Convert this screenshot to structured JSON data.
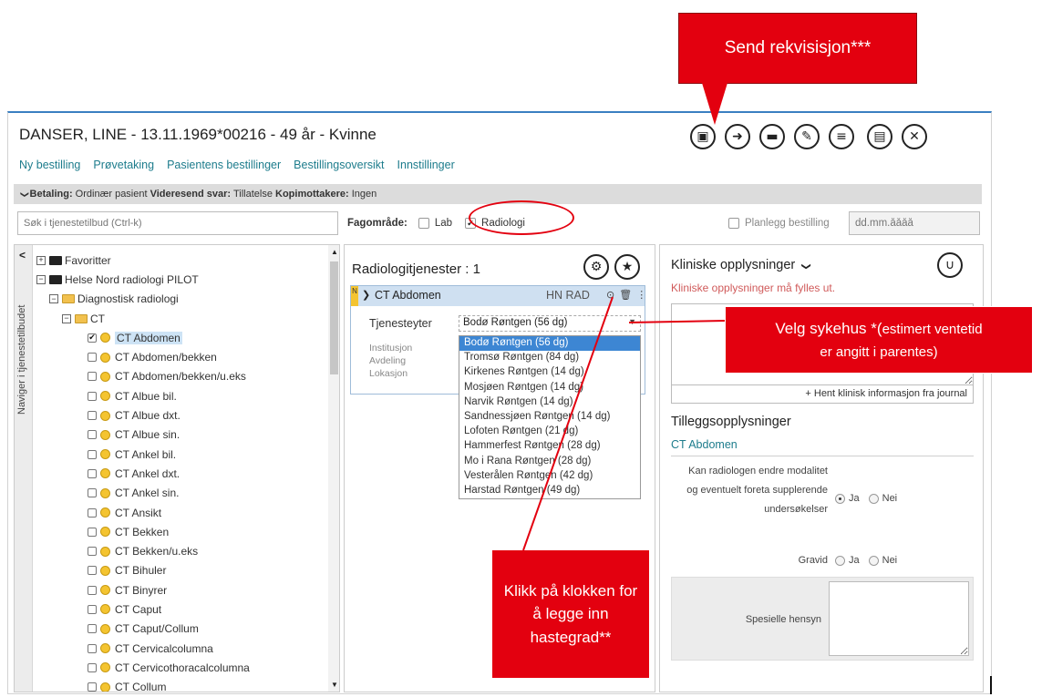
{
  "annotations": {
    "send": "Send rekvisisjon***",
    "velg_main": "Velg sykehus *(",
    "velg_rest": "estimert ventetid",
    "velg_line2": "er angitt i parentes)",
    "klikk": "Klikk på klokken for å legge inn hastegrad**"
  },
  "header": {
    "patient_title": "DANSER, LINE - 13.11.1969*00216 - 49 år - Kvinne",
    "icons": [
      "save-icon",
      "send-icon",
      "message-icon",
      "notes-icon",
      "list-icon",
      "document-icon",
      "close-icon"
    ]
  },
  "nav_tabs": [
    "Ny bestilling",
    "Prøvetaking",
    "Pasientens bestillinger",
    "Bestillingsoversikt",
    "Innstillinger"
  ],
  "info_bar": {
    "chevron": "❯",
    "betaling_label": "Betaling:",
    "betaling_value": "Ordinær pasient",
    "videresend_label": "Videresend svar:",
    "videresend_value": "Tillatelse",
    "kopi_label": "Kopimottakere:",
    "kopi_value": "Ingen"
  },
  "search": {
    "placeholder": "Søk i tjenestetilbud (Ctrl-k)"
  },
  "fagomrade": {
    "label": "Fagområde:",
    "lab": "Lab",
    "lab_checked": false,
    "radiologi": "Radiologi",
    "radiologi_checked": true
  },
  "planlegg": {
    "label": "Planlegg bestilling",
    "date_placeholder": "dd.mm.åååå"
  },
  "sidebar": {
    "vertical_label": "Naviger i tjenestetilbudet"
  },
  "tree": {
    "favoritter": "Favoritter",
    "helse_nord": "Helse Nord radiologi PILOT",
    "diagnostisk": "Diagnostisk radiologi",
    "ct": "CT",
    "items": [
      {
        "label": "CT Abdomen",
        "checked": true
      },
      {
        "label": "CT Abdomen/bekken",
        "checked": false
      },
      {
        "label": "CT Abdomen/bekken/u.eks",
        "checked": false
      },
      {
        "label": "CT Albue bil.",
        "checked": false
      },
      {
        "label": "CT Albue dxt.",
        "checked": false
      },
      {
        "label": "CT Albue sin.",
        "checked": false
      },
      {
        "label": "CT Ankel bil.",
        "checked": false
      },
      {
        "label": "CT Ankel dxt.",
        "checked": false
      },
      {
        "label": "CT Ankel sin.",
        "checked": false
      },
      {
        "label": "CT Ansikt",
        "checked": false
      },
      {
        "label": "CT Bekken",
        "checked": false
      },
      {
        "label": "CT Bekken/u.eks",
        "checked": false
      },
      {
        "label": "CT Bihuler",
        "checked": false
      },
      {
        "label": "CT Binyrer",
        "checked": false
      },
      {
        "label": "CT Caput",
        "checked": false
      },
      {
        "label": "CT Caput/Collum",
        "checked": false
      },
      {
        "label": "CT Cervicalcolumna",
        "checked": false
      },
      {
        "label": "CT Cervicothoracalcolumna",
        "checked": false
      },
      {
        "label": "CT Collum",
        "checked": false
      }
    ]
  },
  "middle": {
    "heading": "Radiologitjenester : 1",
    "card_badge": "N",
    "card_title": "CT Abdomen",
    "card_code": "HN RAD",
    "tjenesteyter_label": "Tjenesteyter",
    "selected_provider": "Bodø Røntgen (56 dg)",
    "meta": [
      "Institusjon",
      "Avdeling",
      "Lokasjon"
    ],
    "providers": [
      "Bodø Røntgen (56 dg)",
      "Tromsø Røntgen (84 dg)",
      "Kirkenes Røntgen (14 dg)",
      "Mosjøen Røntgen (14 dg)",
      "Narvik Røntgen (14 dg)",
      "Sandnessjøen Røntgen (14 dg)",
      "Lofoten Røntgen (21 dg)",
      "Hammerfest Røntgen (28 dg)",
      "Mo i Rana Røntgen (28 dg)",
      "Vesterålen Røntgen (42 dg)",
      "Harstad Røntgen (49 dg)"
    ]
  },
  "right": {
    "klin_heading": "Kliniske opplysninger",
    "klin_warning": "Kliniske opplysninger må fylles ut.",
    "hent_link": "+ Hent klinisk informasjon fra journal",
    "tillegg_heading": "Tilleggsopplysninger",
    "section_title": "CT Abdomen",
    "q_endre": "Kan radiologen endre modalitet og eventuelt foreta supplerende undersøkelser",
    "ja": "Ja",
    "nei": "Nei",
    "q_gravid": "Gravid",
    "hensyn_label": "Spesielle hensyn"
  },
  "colors": {
    "accent_blue": "#3a7fc1",
    "callout_red": "#e3000f",
    "link_teal": "#1d7c8c",
    "warning_red": "#d05a5a"
  }
}
